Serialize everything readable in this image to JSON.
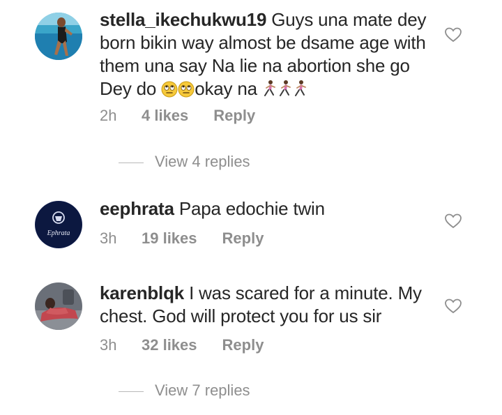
{
  "comments": [
    {
      "username": "stella_ikechukwu19",
      "text_before_emoji": "Guys una mate dey born bikin way almost be dsame age with them una say Na lie na abortion she go Dey do ",
      "text_after_emoji": "okay na ",
      "emojis": [
        "face-with-rolling-eyes",
        "face-with-rolling-eyes",
        "woman-running",
        "woman-running",
        "woman-running"
      ],
      "time": "2h",
      "likes": "4 likes",
      "reply_label": "Reply",
      "view_replies": "View 4 replies"
    },
    {
      "username": "eephrata",
      "text": "Papa edochie twin",
      "avatar_text": "Ephrata",
      "time": "3h",
      "likes": "19 likes",
      "reply_label": "Reply"
    },
    {
      "username": "karenblqk",
      "text": "I was scared for a minute. My chest. God will protect you for us sir",
      "time": "3h",
      "likes": "32 likes",
      "reply_label": "Reply",
      "view_replies": "View 7 replies"
    }
  ],
  "colors": {
    "text": "#262626",
    "secondary": "#8e8e8e",
    "heart_outline": "#8e8e8e",
    "background": "#ffffff"
  }
}
